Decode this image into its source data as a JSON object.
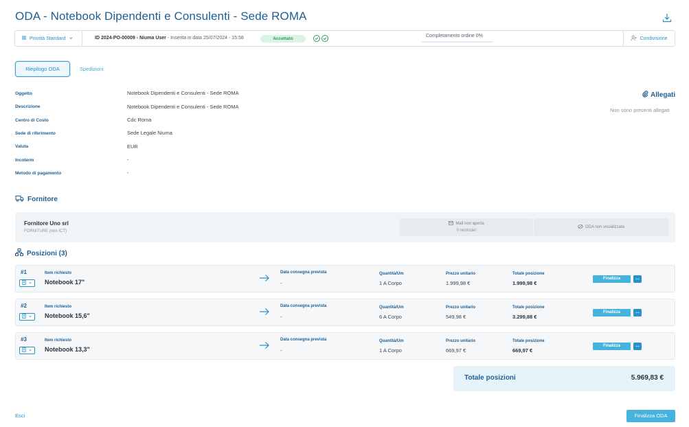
{
  "header": {
    "title": "ODA - Notebook Dipendenti e Consulenti - Sede ROMA"
  },
  "topbar": {
    "priority_label": "Priorità Standard",
    "order_id": "ID 2024-PO-00009 - Niuma User",
    "inserted": " - Inserita in data 25/07/2024 - 15:58",
    "status_badge": "Accettato",
    "progress_label": "Completamento ordine 0%",
    "progress_value": 0,
    "share_label": "Condivisione"
  },
  "tabs": [
    {
      "label": "Riepilogo ODA",
      "active": true
    },
    {
      "label": "Spedizioni",
      "active": false
    }
  ],
  "details": [
    {
      "label": "Oggetto",
      "value": "Notebook Dipendenti e Consulenti - Sede ROMA"
    },
    {
      "label": "Descrizione",
      "value": "Notebook Dipendenti e Consulenti - Sede ROMA"
    },
    {
      "label": "Centro di Costo",
      "value": "Cdc Roma"
    },
    {
      "label": "Sede di riferimento",
      "value": "Sede Legale Niuma"
    },
    {
      "label": "Valuta",
      "value": "EUR"
    },
    {
      "label": "Incoterm",
      "value": "-"
    },
    {
      "label": "Metodo di pagamento",
      "value": "-"
    }
  ],
  "attachments": {
    "title": "Allegati",
    "empty_text": "Non sono presenti allegati"
  },
  "supplier_section": {
    "title": "Fornitore",
    "name": "Fornitore Uno srl",
    "category": "FORNITURE (non ICT)",
    "mail_status": "Mail non aperta",
    "reminders": "0 reminder",
    "view_status": "ODA non visualizzata"
  },
  "positions_section": {
    "title": "Posizioni (3)",
    "labels": {
      "item": "Item richiesto",
      "delivery": "Data consegna prevista",
      "qty": "Quantità/Um",
      "unit_price": "Prezzo unitario",
      "total": "Totale posizione",
      "finalize": "Finalizza",
      "more": "..."
    },
    "rows": [
      {
        "num": "#1",
        "item": "Notebook 17\"",
        "delivery": "-",
        "qty": "1 A Corpo",
        "unit_price": "1.999,98 €",
        "total": "1.999,98 €"
      },
      {
        "num": "#2",
        "item": "Notebook 15,6\"",
        "delivery": "-",
        "qty": "6 A Corpo",
        "unit_price": "549,98 €",
        "total": "3.299,88 €"
      },
      {
        "num": "#3",
        "item": "Notebook 13,3\"",
        "delivery": "-",
        "qty": "1 A Corpo",
        "unit_price": "669,97 €",
        "total": "669,97 €"
      }
    ]
  },
  "totals": {
    "label": "Totale posizioni",
    "value": "5.969,83 €"
  },
  "footer": {
    "exit_label": "Esci",
    "finalize_label": "Finalizza ODA"
  },
  "colors": {
    "primary": "#1e5f93",
    "accent": "#45b3de",
    "success": "#2e9a5c"
  }
}
